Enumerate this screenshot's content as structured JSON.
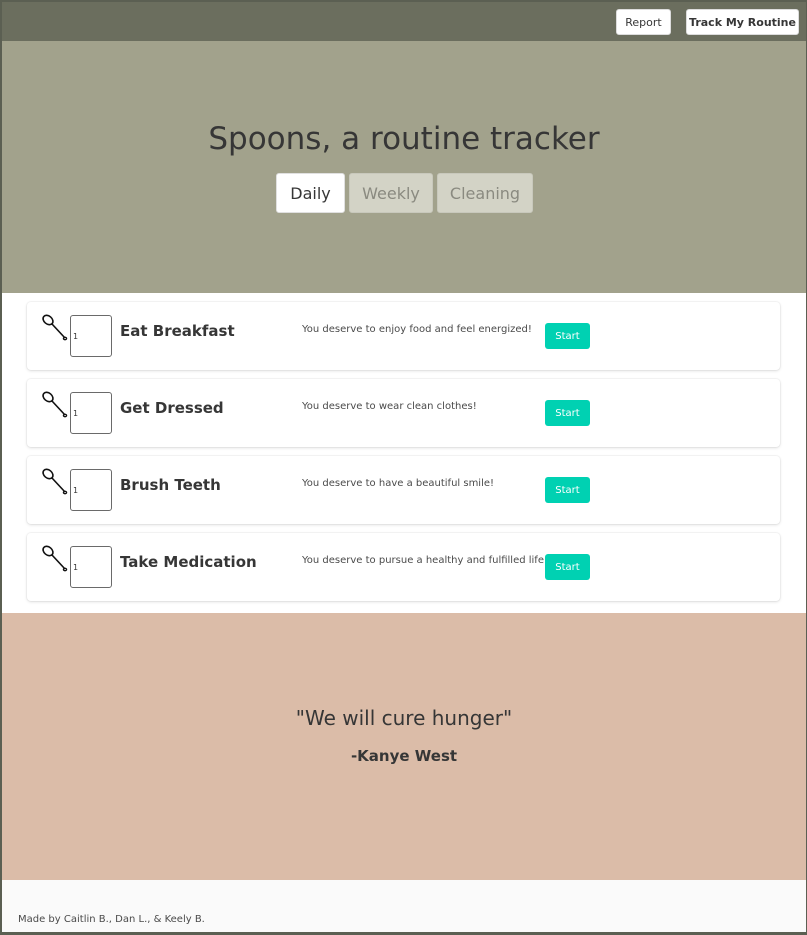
{
  "nav": {
    "report_label": "Report",
    "track_label": "Track My Routine"
  },
  "hero": {
    "title": "Spoons, a routine tracker",
    "tabs": [
      {
        "label": "Daily",
        "active": true
      },
      {
        "label": "Weekly",
        "active": false
      },
      {
        "label": "Cleaning",
        "active": false
      }
    ]
  },
  "tasks": [
    {
      "icon": "spoon-icon",
      "spoons": "1",
      "name": "Eat Breakfast",
      "description": "You deserve to enjoy food and feel energized!",
      "button": "Start"
    },
    {
      "icon": "spoon-icon",
      "spoons": "1",
      "name": "Get Dressed",
      "description": "You deserve to wear clean clothes!",
      "button": "Start"
    },
    {
      "icon": "spoon-icon",
      "spoons": "1",
      "name": "Brush Teeth",
      "description": "You deserve to have a beautiful smile!",
      "button": "Start"
    },
    {
      "icon": "spoon-icon",
      "spoons": "1",
      "name": "Take Medication",
      "description": "You deserve to pursue a healthy and fulfilled life",
      "button": "Start"
    }
  ],
  "quote": {
    "text": "\"We will cure hunger\"",
    "author": "-Kanye West"
  },
  "footer": {
    "credits": "Made by Caitlin B., Dan L., & Keely B."
  },
  "colors": {
    "navbar": "#6b6e5e",
    "hero": "#a2a28c",
    "accent": "#00d1b2",
    "quote_bg": "#dbbca8"
  }
}
